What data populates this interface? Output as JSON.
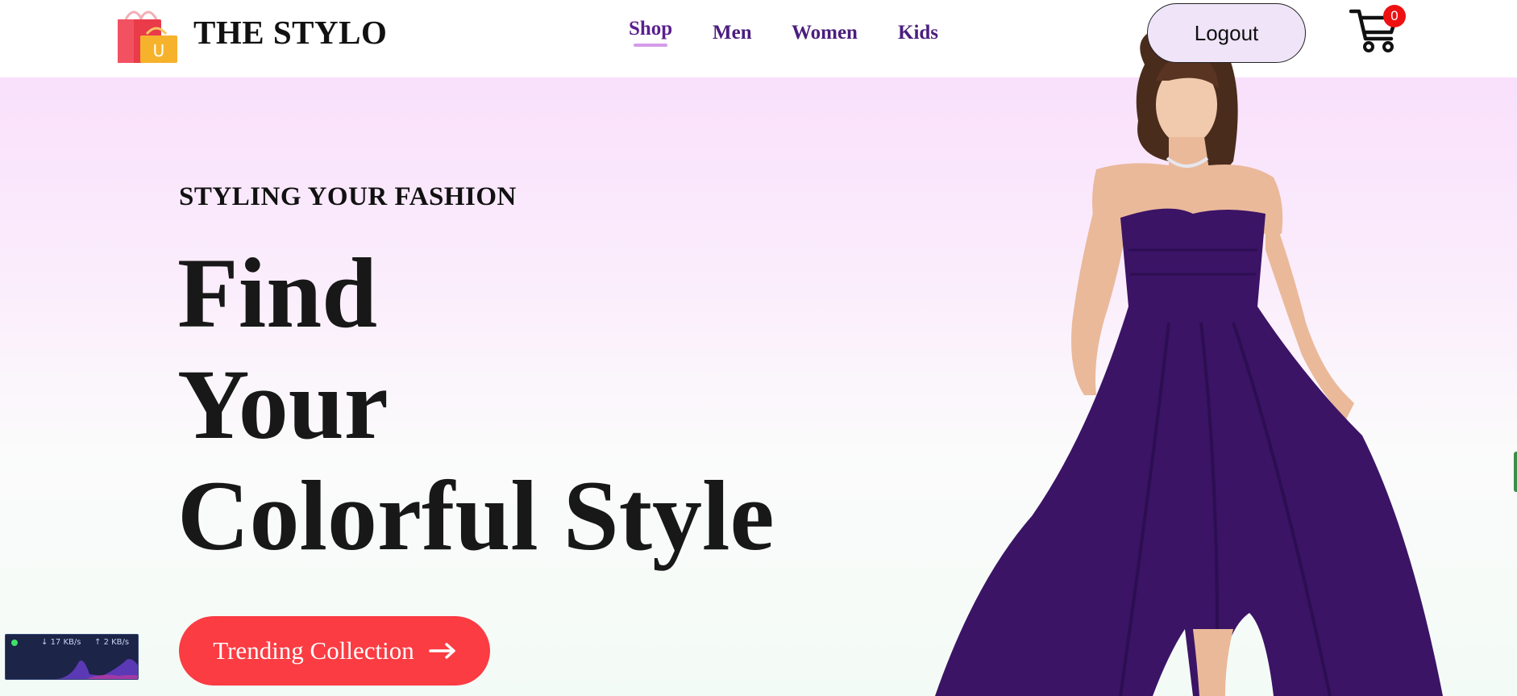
{
  "header": {
    "brand": "THE STYLO",
    "logo_icon": "shopping-bags-icon",
    "nav": [
      {
        "label": "Shop",
        "active": true
      },
      {
        "label": "Men",
        "active": false
      },
      {
        "label": "Women",
        "active": false
      },
      {
        "label": "Kids",
        "active": false
      }
    ],
    "logout_label": "Logout",
    "cart_icon": "shopping-cart-icon",
    "cart_count": "0"
  },
  "hero": {
    "tagline": "STYLING YOUR FASHION",
    "headline": [
      "Find",
      "Your",
      "Colorful Style"
    ],
    "cta_label": "Trending Collection",
    "cta_icon": "arrow-right-icon",
    "image": "model-in-purple-dress",
    "dress_color": "#3b1466"
  },
  "network_widget": {
    "download": "17 KB/s",
    "upload": "2 KB/s",
    "status_color": "#3fe067"
  },
  "colors": {
    "accent": "#fb3c43",
    "nav_text": "#4b1e7e",
    "nav_underline": "#d49ce9",
    "cart_badge": "#ee1111"
  }
}
